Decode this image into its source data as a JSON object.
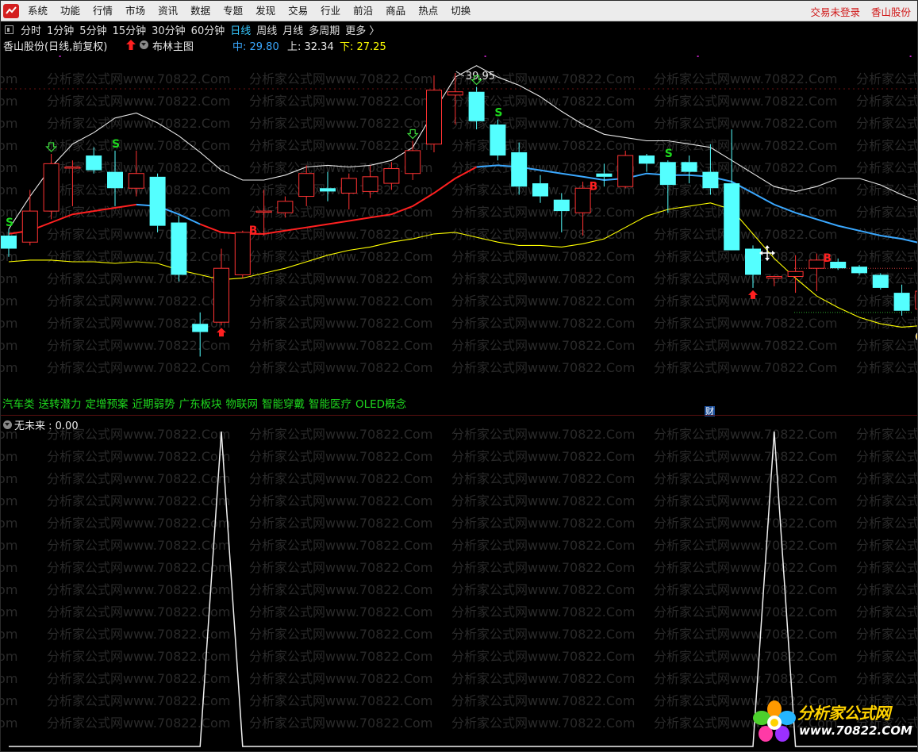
{
  "menu": {
    "items": [
      "系统",
      "功能",
      "行情",
      "市场",
      "资讯",
      "数据",
      "专题",
      "发现",
      "交易",
      "行业",
      "前沿",
      "商品",
      "热点",
      "切换"
    ],
    "right": [
      "交易未登录",
      "香山股份"
    ]
  },
  "periods": {
    "items": [
      "分时",
      "1分钟",
      "5分钟",
      "15分钟",
      "30分钟",
      "60分钟",
      "日线",
      "周线",
      "月线",
      "多周期",
      "更多 〉"
    ],
    "active": "日线"
  },
  "info": {
    "stock_title": "香山股份(日线,前复权)",
    "indicator_name": "布林主图",
    "mid_text": "中: 29.80",
    "up_text": "上: 32.34",
    "low_text": "下: 27.25"
  },
  "watermark_text": "分析家公式网www.70822.Com",
  "concepts": [
    "汽车类",
    "送转潜力",
    "定增预案",
    "近期弱势",
    "广东板块",
    "物联网",
    "智能穿戴",
    "智能医疗",
    "OLED概念"
  ],
  "finance_badge": "财",
  "sub_indicator": {
    "label": "无未来 : 0.00"
  },
  "logo": {
    "name": "分析家公式网",
    "url": "www.70822.COM"
  },
  "colors": {
    "up": "#ff3232",
    "down": "#54ffff",
    "boll_mid_left": "#ff2020",
    "boll_mid_right": "#3aa8ff",
    "boll_upper": "#e8e8e8",
    "boll_lower": "#ffff00",
    "signal_s": "#1ed81e",
    "signal_b": "#ff2020"
  },
  "chart_data": {
    "type": "candlestick",
    "price_labels": [
      {
        "value": 39.95,
        "text": "39.95"
      }
    ],
    "candles": [
      {
        "o": 30.0,
        "h": 30.4,
        "l": 28.7,
        "c": 29.2
      },
      {
        "o": 29.6,
        "h": 32.8,
        "l": 29.4,
        "c": 31.5
      },
      {
        "o": 31.5,
        "h": 35.0,
        "l": 31.0,
        "c": 34.4
      },
      {
        "o": 34.2,
        "h": 34.6,
        "l": 31.8,
        "c": 34.2
      },
      {
        "o": 34.9,
        "h": 35.4,
        "l": 33.8,
        "c": 34.0
      },
      {
        "o": 33.9,
        "h": 35.2,
        "l": 31.8,
        "c": 32.9
      },
      {
        "o": 32.9,
        "h": 35.2,
        "l": 32.4,
        "c": 33.8
      },
      {
        "o": 33.6,
        "h": 33.8,
        "l": 30.2,
        "c": 30.6
      },
      {
        "o": 30.8,
        "h": 31.2,
        "l": 27.2,
        "c": 27.6
      },
      {
        "o": 24.6,
        "h": 25.3,
        "l": 22.6,
        "c": 24.1
      },
      {
        "o": 24.7,
        "h": 29.2,
        "l": 24.5,
        "c": 28.0
      },
      {
        "o": 27.6,
        "h": 30.3,
        "l": 27.4,
        "c": 30.2
      },
      {
        "o": 31.5,
        "h": 32.8,
        "l": 30.0,
        "c": 31.5
      },
      {
        "o": 31.4,
        "h": 32.4,
        "l": 31.1,
        "c": 32.1
      },
      {
        "o": 32.4,
        "h": 34.3,
        "l": 31.8,
        "c": 33.8
      },
      {
        "o": 32.9,
        "h": 33.9,
        "l": 32.1,
        "c": 32.7
      },
      {
        "o": 32.6,
        "h": 33.8,
        "l": 31.6,
        "c": 33.5
      },
      {
        "o": 32.7,
        "h": 34.3,
        "l": 32.3,
        "c": 33.6
      },
      {
        "o": 33.2,
        "h": 34.5,
        "l": 32.8,
        "c": 34.1
      },
      {
        "o": 33.8,
        "h": 35.8,
        "l": 33.4,
        "c": 35.2
      },
      {
        "o": 35.6,
        "h": 39.8,
        "l": 35.1,
        "c": 38.9
      },
      {
        "o": 38.6,
        "h": 39.95,
        "l": 36.8,
        "c": 38.8
      },
      {
        "o": 38.8,
        "h": 39.1,
        "l": 36.5,
        "c": 37.0
      },
      {
        "o": 36.8,
        "h": 37.1,
        "l": 34.6,
        "c": 34.9
      },
      {
        "o": 35.1,
        "h": 35.7,
        "l": 32.5,
        "c": 33.0
      },
      {
        "o": 33.2,
        "h": 33.7,
        "l": 32.0,
        "c": 32.4
      },
      {
        "o": 32.2,
        "h": 32.6,
        "l": 30.2,
        "c": 31.5
      },
      {
        "o": 31.4,
        "h": 33.3,
        "l": 30.0,
        "c": 32.9
      },
      {
        "o": 33.8,
        "h": 34.4,
        "l": 33.0,
        "c": 33.6
      },
      {
        "o": 33.0,
        "h": 35.2,
        "l": 32.9,
        "c": 34.9
      },
      {
        "o": 34.9,
        "h": 35.0,
        "l": 33.9,
        "c": 34.4
      },
      {
        "o": 34.5,
        "h": 34.6,
        "l": 31.4,
        "c": 33.1
      },
      {
        "o": 34.5,
        "h": 34.9,
        "l": 33.2,
        "c": 33.9
      },
      {
        "o": 33.9,
        "h": 35.6,
        "l": 32.5,
        "c": 32.9
      },
      {
        "o": 33.2,
        "h": 36.5,
        "l": 33.0,
        "c": 29.1
      },
      {
        "o": 29.2,
        "h": 29.4,
        "l": 26.8,
        "c": 27.6
      },
      {
        "o": 27.4,
        "h": 27.5,
        "l": 26.9,
        "c": 27.5
      },
      {
        "o": 27.5,
        "h": 28.8,
        "l": 26.5,
        "c": 27.8
      },
      {
        "o": 28.0,
        "h": 28.9,
        "l": 26.6,
        "c": 28.5
      },
      {
        "o": 28.4,
        "h": 28.6,
        "l": 27.9,
        "c": 28.0
      },
      {
        "o": 28.1,
        "h": 28.2,
        "l": 27.6,
        "c": 27.7
      },
      {
        "o": 27.6,
        "h": 27.7,
        "l": 26.7,
        "c": 26.8
      },
      {
        "o": 26.5,
        "h": 27.0,
        "l": 25.1,
        "c": 25.4
      },
      {
        "o": 25.5,
        "h": 27.0,
        "l": 24.7,
        "c": 26.6
      }
    ],
    "boll_upper": [
      30.4,
      32.4,
      34.2,
      35.6,
      36.3,
      37.2,
      37.5,
      36.9,
      36.1,
      35.1,
      34.0,
      33.4,
      33.4,
      33.7,
      34.2,
      34.3,
      34.2,
      34.3,
      34.6,
      35.4,
      37.6,
      39.7,
      40.4,
      39.7,
      39.2,
      38.5,
      37.6,
      36.8,
      36.2,
      36.0,
      35.8,
      35.8,
      35.6,
      35.4,
      34.6,
      33.8,
      33.0,
      32.7,
      33.0,
      33.5,
      33.5,
      33.1,
      32.5,
      32.0
    ],
    "boll_mid": [
      30.1,
      30.3,
      30.8,
      31.3,
      31.5,
      31.7,
      31.9,
      31.8,
      31.3,
      30.7,
      30.2,
      30.1,
      30.1,
      30.3,
      30.5,
      30.7,
      30.9,
      31.1,
      31.3,
      31.8,
      32.6,
      33.5,
      34.2,
      34.3,
      34.2,
      34.0,
      33.8,
      33.6,
      33.4,
      33.5,
      33.8,
      33.7,
      33.7,
      33.6,
      33.3,
      32.6,
      31.9,
      31.4,
      31.0,
      30.6,
      30.3,
      30.0,
      29.8,
      29.5
    ],
    "boll_lower": [
      28.4,
      28.5,
      28.5,
      28.4,
      28.4,
      28.3,
      28.4,
      28.3,
      27.9,
      27.6,
      27.3,
      27.4,
      27.7,
      28.0,
      28.4,
      28.8,
      29.1,
      29.3,
      29.6,
      29.8,
      30.1,
      30.2,
      29.9,
      29.6,
      29.4,
      29.4,
      29.3,
      29.5,
      29.8,
      30.5,
      31.2,
      31.6,
      31.8,
      32.0,
      31.6,
      30.1,
      28.6,
      27.4,
      26.3,
      25.6,
      25.0,
      24.6,
      24.4,
      24.5
    ],
    "signals": [
      {
        "i": 0,
        "type": "S"
      },
      {
        "i": 2,
        "type": "down-arrow"
      },
      {
        "i": 5,
        "type": "S"
      },
      {
        "i": 10,
        "type": "up-arrow"
      },
      {
        "i": 11,
        "type": "B"
      },
      {
        "i": 19,
        "type": "down-arrow"
      },
      {
        "i": 22,
        "type": "down-arrow"
      },
      {
        "i": 23,
        "type": "S"
      },
      {
        "i": 27,
        "type": "B"
      },
      {
        "i": 31,
        "type": "S"
      },
      {
        "i": 35,
        "type": "up-arrow"
      },
      {
        "i": 38,
        "type": "B"
      },
      {
        "i": 43,
        "type": "coin"
      }
    ],
    "reference_lines": [
      28.0,
      25.3
    ],
    "sub_series": [
      0,
      0,
      0,
      0,
      0,
      0,
      0,
      0,
      0,
      0,
      1,
      0,
      0,
      0,
      0,
      0,
      0,
      0,
      0,
      0,
      0,
      0,
      0,
      0,
      0,
      0,
      0,
      0,
      0,
      0,
      0,
      0,
      0,
      0,
      0,
      0,
      1,
      0,
      0,
      0,
      0,
      0,
      0,
      0
    ]
  }
}
